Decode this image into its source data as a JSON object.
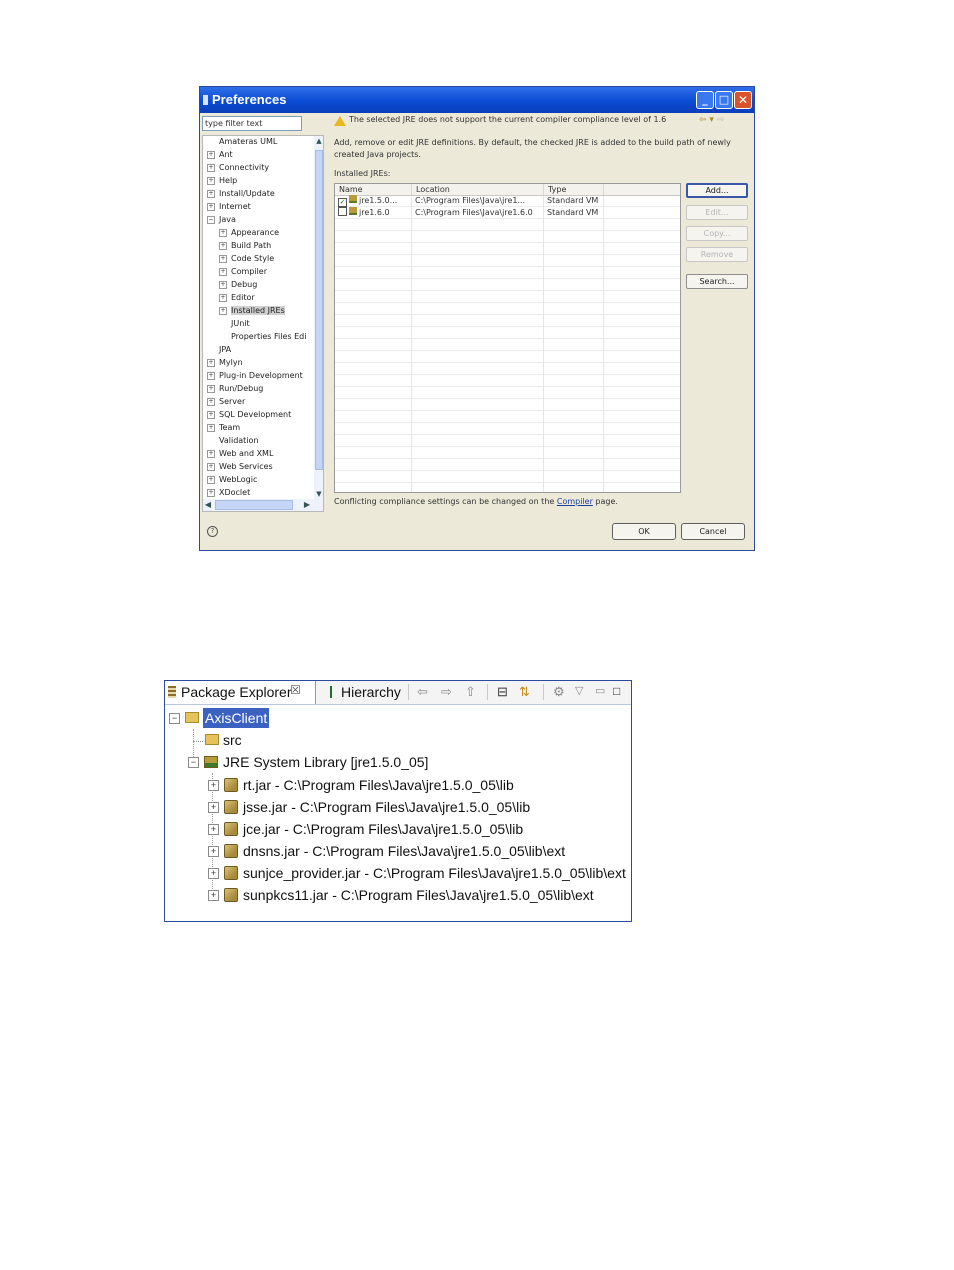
{
  "preferences": {
    "title": "Preferences",
    "filter_placeholder": "type filter text",
    "tree": [
      {
        "label": "Amateras UML",
        "indent": 0,
        "exp": ""
      },
      {
        "label": "Ant",
        "indent": 0,
        "exp": "+"
      },
      {
        "label": "Connectivity",
        "indent": 0,
        "exp": "+"
      },
      {
        "label": "Help",
        "indent": 0,
        "exp": "+"
      },
      {
        "label": "Install/Update",
        "indent": 0,
        "exp": "+"
      },
      {
        "label": "Internet",
        "indent": 0,
        "exp": "+"
      },
      {
        "label": "Java",
        "indent": 0,
        "exp": "−"
      },
      {
        "label": "Appearance",
        "indent": 1,
        "exp": "+"
      },
      {
        "label": "Build Path",
        "indent": 1,
        "exp": "+"
      },
      {
        "label": "Code Style",
        "indent": 1,
        "exp": "+"
      },
      {
        "label": "Compiler",
        "indent": 1,
        "exp": "+"
      },
      {
        "label": "Debug",
        "indent": 1,
        "exp": "+"
      },
      {
        "label": "Editor",
        "indent": 1,
        "exp": "+"
      },
      {
        "label": "Installed JREs",
        "indent": 1,
        "exp": "+",
        "selected": true
      },
      {
        "label": "JUnit",
        "indent": 1,
        "exp": ""
      },
      {
        "label": "Properties Files Edi",
        "indent": 1,
        "exp": ""
      },
      {
        "label": "JPA",
        "indent": 0,
        "exp": ""
      },
      {
        "label": "Mylyn",
        "indent": 0,
        "exp": "+"
      },
      {
        "label": "Plug-in Development",
        "indent": 0,
        "exp": "+"
      },
      {
        "label": "Run/Debug",
        "indent": 0,
        "exp": "+"
      },
      {
        "label": "Server",
        "indent": 0,
        "exp": "+"
      },
      {
        "label": "SQL Development",
        "indent": 0,
        "exp": "+"
      },
      {
        "label": "Team",
        "indent": 0,
        "exp": "+"
      },
      {
        "label": "Validation",
        "indent": 0,
        "exp": ""
      },
      {
        "label": "Web and XML",
        "indent": 0,
        "exp": "+"
      },
      {
        "label": "Web Services",
        "indent": 0,
        "exp": "+"
      },
      {
        "label": "WebLogic",
        "indent": 0,
        "exp": "+"
      },
      {
        "label": "XDoclet",
        "indent": 0,
        "exp": "+"
      }
    ],
    "warning": "The selected JRE does not support the current compiler compliance level of 1.6",
    "description": "Add, remove or edit JRE definitions. By default, the checked JRE is added to the build path of newly created Java projects.",
    "installed_label": "Installed JREs:",
    "columns": [
      "Name",
      "Location",
      "Type"
    ],
    "jres": [
      {
        "checked": true,
        "name": "jre1.5.0...",
        "location": "C:\\Program Files\\Java\\jre1...",
        "type": "Standard VM"
      },
      {
        "checked": false,
        "name": "jre1.6.0",
        "location": "C:\\Program Files\\Java\\jre1.6.0",
        "type": "Standard VM"
      }
    ],
    "buttons": {
      "add": "Add...",
      "edit": "Edit...",
      "copy": "Copy...",
      "remove": "Remove",
      "search": "Search..."
    },
    "footer_prefix": "Conflicting compliance settings can be changed on the ",
    "footer_link": "Compiler",
    "footer_suffix": " page.",
    "ok": "OK",
    "cancel": "Cancel"
  },
  "package_explorer": {
    "tab_label": "Package Explorer",
    "tab2_label": "Hierarchy",
    "project": "AxisClient",
    "src": "src",
    "library": "JRE System Library [jre1.5.0_05]",
    "jars": [
      "rt.jar - C:\\Program Files\\Java\\jre1.5.0_05\\lib",
      "jsse.jar - C:\\Program Files\\Java\\jre1.5.0_05\\lib",
      "jce.jar - C:\\Program Files\\Java\\jre1.5.0_05\\lib",
      "dnsns.jar - C:\\Program Files\\Java\\jre1.5.0_05\\lib\\ext",
      "sunjce_provider.jar - C:\\Program Files\\Java\\jre1.5.0_05\\lib\\ext",
      "sunpkcs11.jar - C:\\Program Files\\Java\\jre1.5.0_05\\lib\\ext"
    ]
  },
  "icons": {
    "minimize": "minimize-icon",
    "maximize": "maximize-icon",
    "close": "close-icon",
    "help": "help-icon",
    "warning": "warning-icon"
  }
}
